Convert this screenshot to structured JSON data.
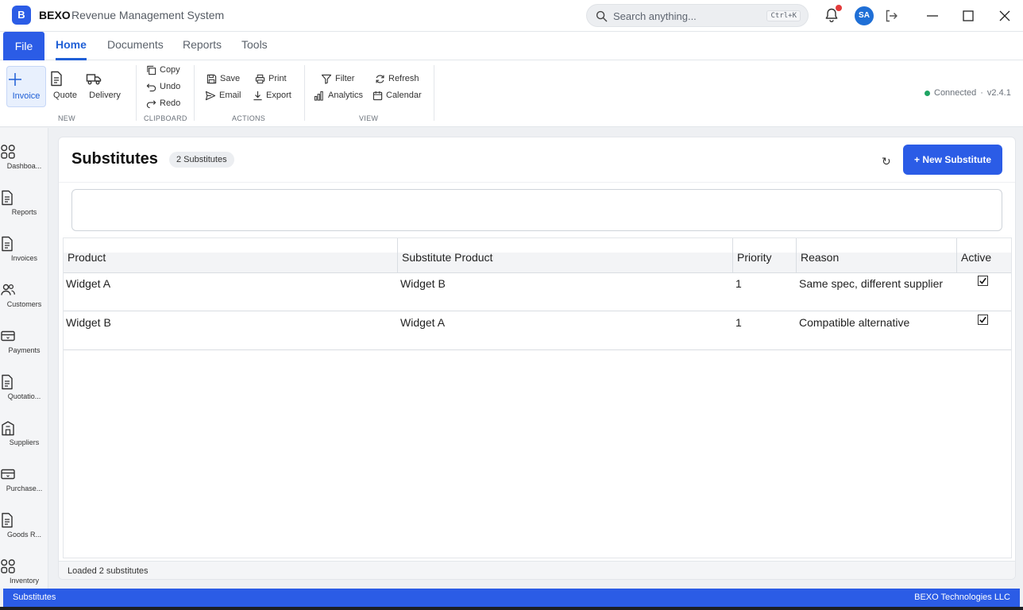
{
  "app": {
    "logo_letter": "B",
    "brand": "BEXO",
    "subtitle": "Revenue Management System"
  },
  "search": {
    "placeholder": "Search anything...",
    "shortcut": "Ctrl+K"
  },
  "user": {
    "initials": "SA"
  },
  "menu": {
    "file": "File",
    "tabs": [
      "Home",
      "Documents",
      "Reports",
      "Tools"
    ],
    "active_tab": "Home"
  },
  "ribbon": {
    "new": {
      "label": "NEW",
      "items": [
        "Invoice",
        "Quote",
        "Delivery"
      ]
    },
    "clipboard": {
      "label": "CLIPBOARD",
      "items": [
        "Copy",
        "Undo",
        "Redo"
      ]
    },
    "actions": {
      "label": "ACTIONS",
      "items": [
        "Save",
        "Print",
        "Email",
        "Export"
      ]
    },
    "view": {
      "label": "VIEW",
      "items": [
        "Filter",
        "Refresh",
        "Analytics",
        "Calendar"
      ]
    },
    "status": {
      "text": "Connected",
      "separator": "·",
      "version": "v2.4.1",
      "color": "#1fa463"
    }
  },
  "sidebar": {
    "items": [
      {
        "label": "Dashboa...",
        "icon": "grid-icon"
      },
      {
        "label": "Reports",
        "icon": "document-icon"
      },
      {
        "label": "Invoices",
        "icon": "document-icon"
      },
      {
        "label": "Customers",
        "icon": "users-icon"
      },
      {
        "label": "Payments",
        "icon": "card-icon"
      },
      {
        "label": "Quotatio...",
        "icon": "document-icon"
      },
      {
        "label": "Suppliers",
        "icon": "building-icon"
      },
      {
        "label": "Purchase...",
        "icon": "card-icon"
      },
      {
        "label": "Goods R...",
        "icon": "document-icon"
      },
      {
        "label": "Inventory",
        "icon": "grid-icon"
      }
    ]
  },
  "page": {
    "title": "Substitutes",
    "count_badge": "2 Substitutes",
    "refresh_symbol": "↻",
    "new_button": "+ New Substitute"
  },
  "table": {
    "columns": [
      "Product",
      "Substitute Product",
      "Priority",
      "Reason",
      "Active"
    ],
    "rows": [
      {
        "product": "Widget A",
        "substitute": "Widget B",
        "priority": "1",
        "reason": "Same spec, different supplier",
        "active": true
      },
      {
        "product": "Widget B",
        "substitute": "Widget A",
        "priority": "1",
        "reason": "Compatible alternative",
        "active": true
      }
    ]
  },
  "footer": {
    "status": "Loaded 2 substitutes"
  },
  "statusbar": {
    "left": "Substitutes",
    "right": "BEXO Technologies LLC"
  },
  "colors": {
    "accent": "#2b5ce6",
    "active_tab": "#1f5fd6",
    "notification": "#e33b3b"
  }
}
